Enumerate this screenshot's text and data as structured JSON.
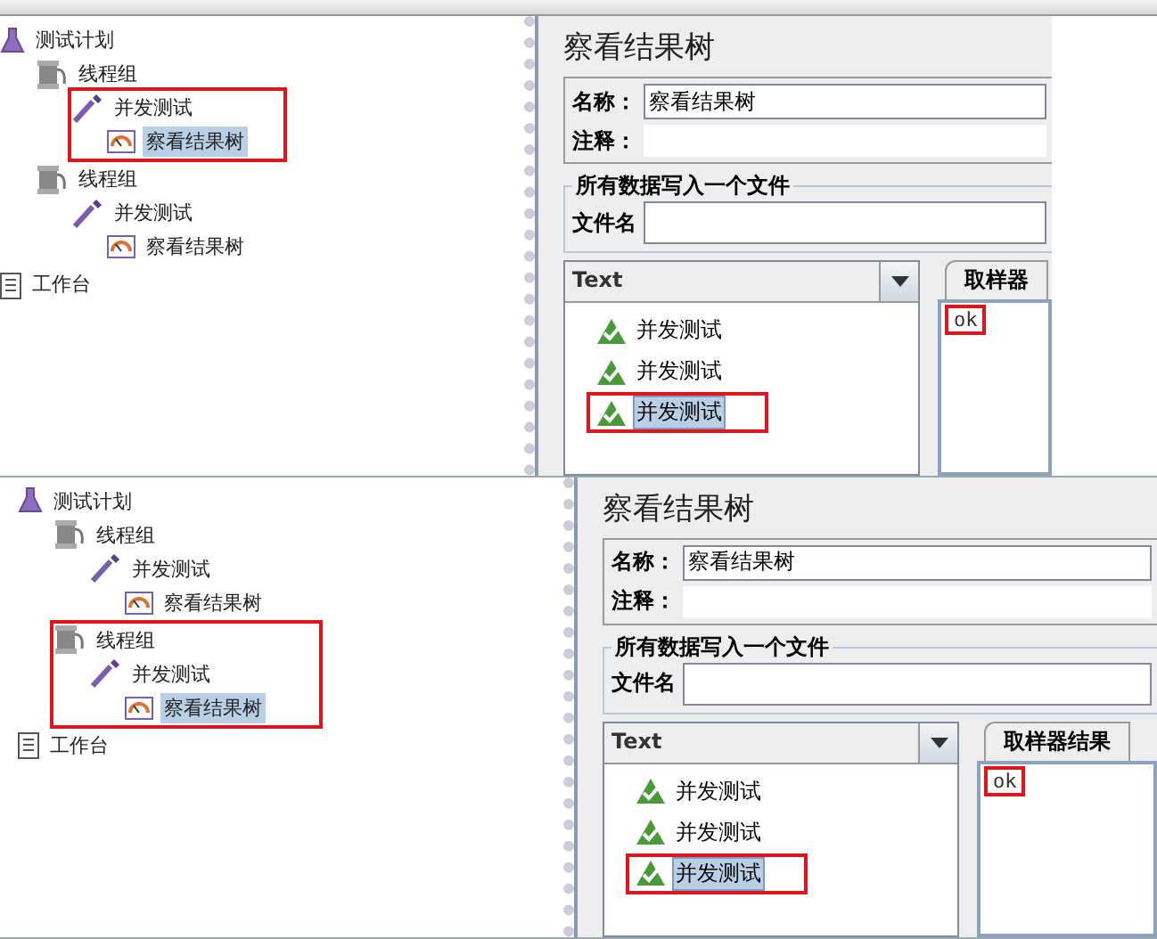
{
  "screens": [
    {
      "tree": [
        {
          "label": "测试计划",
          "kind": "plan",
          "selected": false,
          "highlighted": false,
          "children": [
            {
              "label": "线程组",
              "kind": "group",
              "selected": false,
              "highlighted": false,
              "children": [
                {
                  "label": "并发测试",
                  "kind": "sampler",
                  "selected": false,
                  "highlighted": true,
                  "children": [
                    {
                      "label": "察看结果树",
                      "kind": "listener",
                      "selected": true,
                      "highlighted": false
                    }
                  ]
                }
              ]
            },
            {
              "label": "线程组",
              "kind": "group",
              "selected": false,
              "highlighted": false,
              "children": [
                {
                  "label": "并发测试",
                  "kind": "sampler",
                  "selected": false,
                  "highlighted": false,
                  "children": [
                    {
                      "label": "察看结果树",
                      "kind": "listener",
                      "selected": false,
                      "highlighted": false
                    }
                  ]
                }
              ]
            }
          ]
        },
        {
          "label": "工作台",
          "kind": "bench",
          "selected": false,
          "highlighted": false
        }
      ],
      "title": "察看结果树",
      "name_label": "名称：",
      "name_value": "察看结果树",
      "comment_label": "注释：",
      "file_legend": "所有数据写入一个文件",
      "file_label": "文件名",
      "renderer": "Text",
      "results": [
        {
          "label": "并发测试",
          "selected": false,
          "highlighted": false
        },
        {
          "label": "并发测试",
          "selected": false,
          "highlighted": false
        },
        {
          "label": "并发测试",
          "selected": true,
          "highlighted": true
        }
      ],
      "tabs": [
        {
          "label": "取样器",
          "selected": true
        }
      ],
      "response": "ok",
      "response_highlighted": true
    },
    {
      "tree": [
        {
          "label": "测试计划",
          "kind": "plan",
          "selected": false,
          "highlighted": false,
          "children": [
            {
              "label": "线程组",
              "kind": "group",
              "selected": false,
              "highlighted": false,
              "children": [
                {
                  "label": "并发测试",
                  "kind": "sampler",
                  "selected": false,
                  "highlighted": false,
                  "children": [
                    {
                      "label": "察看结果树",
                      "kind": "listener",
                      "selected": false,
                      "highlighted": false
                    }
                  ]
                }
              ]
            },
            {
              "label": "线程组",
              "kind": "group",
              "selected": false,
              "highlighted": true,
              "children": [
                {
                  "label": "并发测试",
                  "kind": "sampler",
                  "selected": false,
                  "highlighted": false,
                  "children": [
                    {
                      "label": "察看结果树",
                      "kind": "listener",
                      "selected": true,
                      "highlighted": false
                    }
                  ]
                }
              ]
            }
          ]
        },
        {
          "label": "工作台",
          "kind": "bench",
          "selected": false,
          "highlighted": false
        }
      ],
      "title": "察看结果树",
      "name_label": "名称：",
      "name_value": "察看结果树",
      "comment_label": "注释：",
      "file_legend": "所有数据写入一个文件",
      "file_label": "文件名",
      "renderer": "Text",
      "results": [
        {
          "label": "并发测试",
          "selected": false,
          "highlighted": false
        },
        {
          "label": "并发测试",
          "selected": false,
          "highlighted": false
        },
        {
          "label": "并发测试",
          "selected": true,
          "highlighted": true
        }
      ],
      "tabs": [
        {
          "label": "取样器结果",
          "selected": true
        }
      ],
      "response": "ok",
      "response_highlighted": true
    }
  ]
}
